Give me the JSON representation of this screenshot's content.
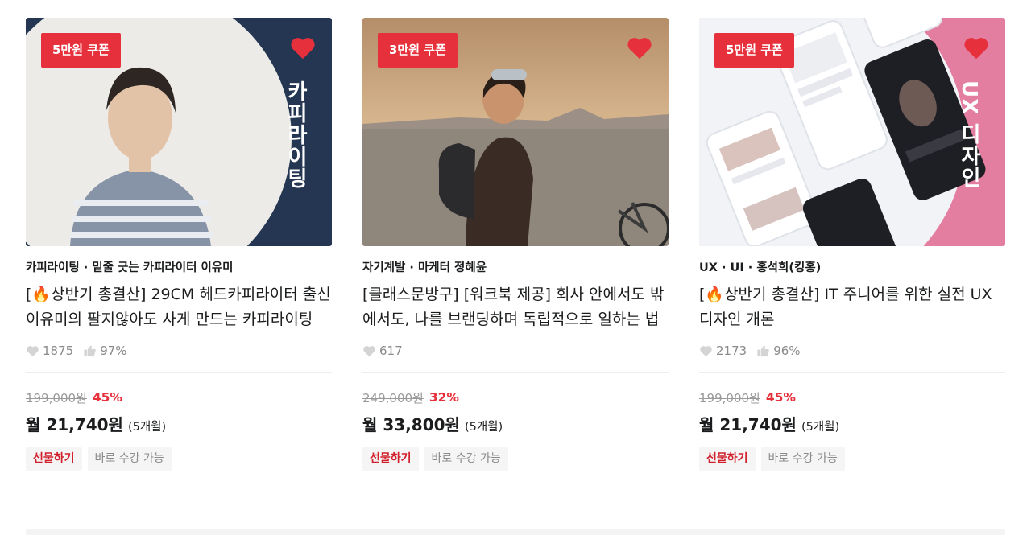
{
  "cards": [
    {
      "coupon": "5만원 쿠폰",
      "side_label": "카피라이팅",
      "category": "카피라이팅 · 밑줄 긋는 카피라이터 이유미",
      "title": "[🔥상반기 총결산] 29CM 헤드카피라이터 출신 이유미의 팔지않아도 사게 만드는 카피라이팅",
      "likes": "1875",
      "rating": "97%",
      "original_price": "199,000원",
      "discount": "45%",
      "monthly_price": "월 21,740원",
      "months": "(5개월)",
      "gift_label": "선물하기",
      "instant_label": "바로 수강 가능",
      "colors": {
        "panel": "#243652",
        "circle": "#ecebe8"
      }
    },
    {
      "coupon": "3만원 쿠폰",
      "side_label": "",
      "category": "자기계발 · 마케터 정혜윤",
      "title": "[클래스문방구] [워크북 제공] 회사 안에서도 밖에서도, 나를 브랜딩하며 독립적으로 일하는 법",
      "likes": "617",
      "rating": "",
      "original_price": "249,000원",
      "discount": "32%",
      "monthly_price": "월 33,800원",
      "months": "(5개월)",
      "gift_label": "선물하기",
      "instant_label": "바로 수강 가능",
      "colors": {
        "sky": "#c9a47e",
        "ground": "#8d8277"
      }
    },
    {
      "coupon": "5만원 쿠폰",
      "side_label": "UX 디자인",
      "category": "UX · UI · 홍석희(킹홍)",
      "title": "[🔥상반기 총결산] IT 주니어를 위한 실전 UX 디자인 개론",
      "likes": "2173",
      "rating": "96%",
      "original_price": "199,000원",
      "discount": "45%",
      "monthly_price": "월 21,740원",
      "months": "(5개월)",
      "gift_label": "선물하기",
      "instant_label": "바로 수강 가능",
      "colors": {
        "panel": "#e37ea0",
        "circle": "#f2f3f6"
      }
    }
  ],
  "icons": {
    "heart": "heart-icon",
    "like": "heart-outline-icon",
    "thumb": "thumbs-up-icon"
  },
  "accent": "#e6303b"
}
